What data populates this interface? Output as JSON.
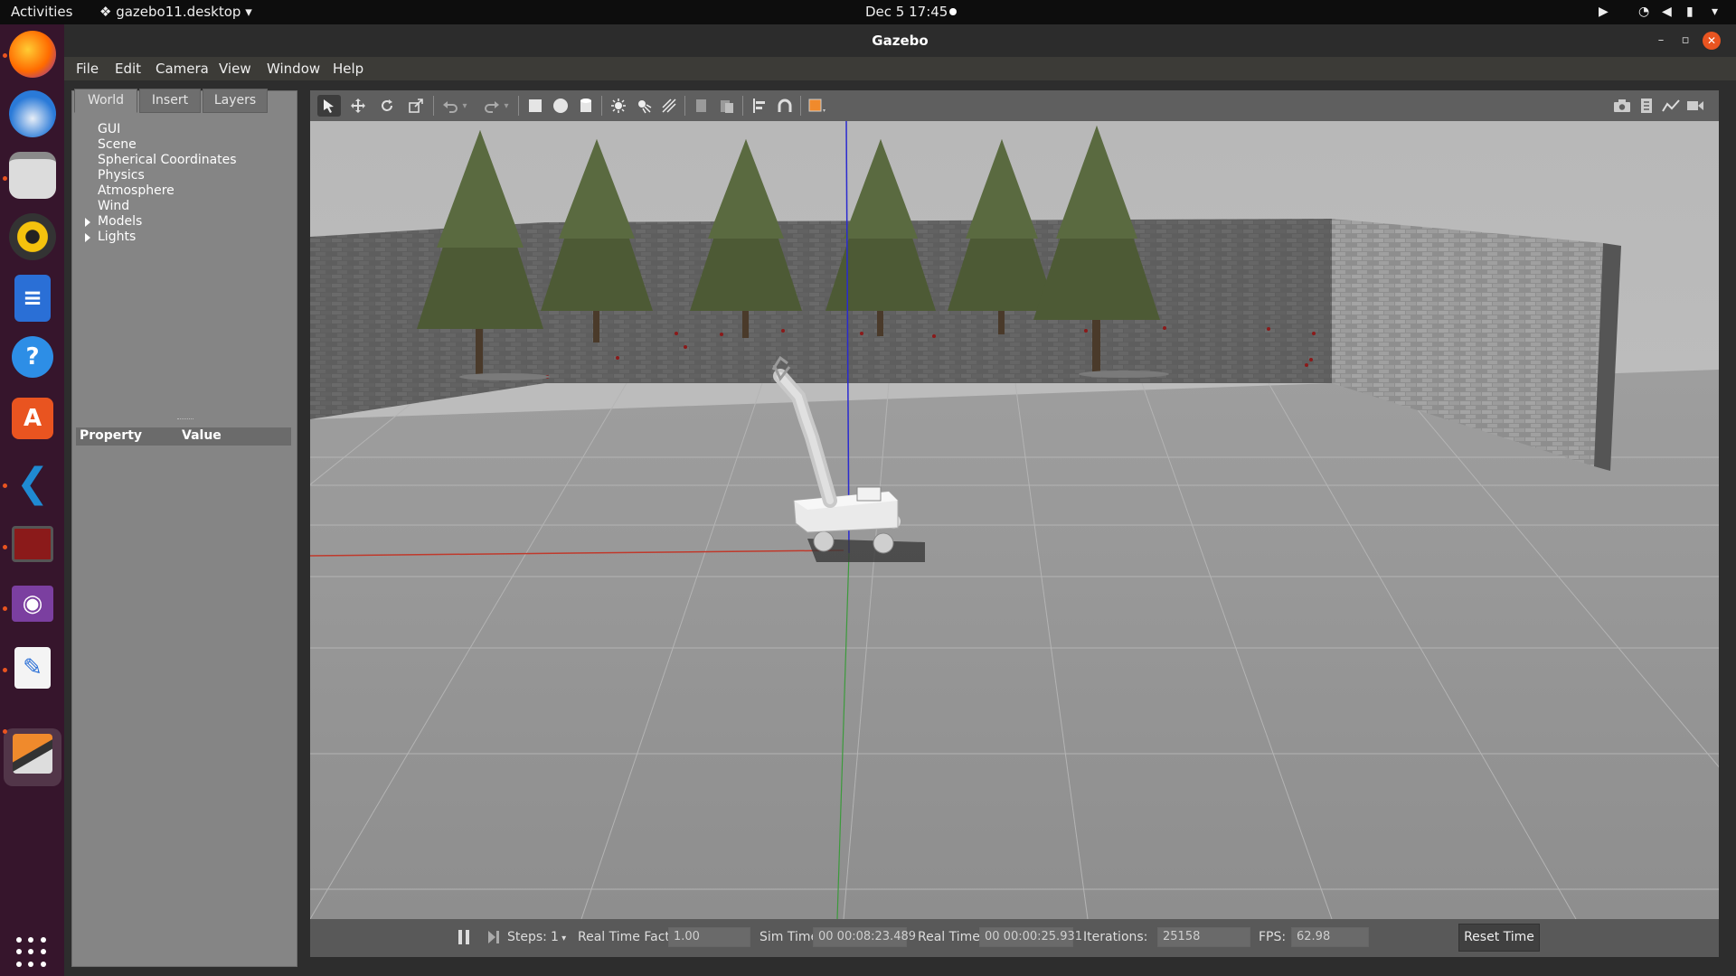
{
  "topbar": {
    "activities": "Activities",
    "app_menu": "gazebo11.desktop",
    "clock": "Dec 5  17:45"
  },
  "dock": {
    "items": [
      {
        "icon": "firefox-icon",
        "color": "#ff7139"
      },
      {
        "icon": "thunderbird-icon",
        "color": "#2a7ad8"
      },
      {
        "icon": "files-icon",
        "color": "#e5e5e5"
      },
      {
        "icon": "rhythmbox-icon",
        "color": "#f4c20d"
      },
      {
        "icon": "libreoffice-writer-icon",
        "color": "#2a6fd6"
      },
      {
        "icon": "help-icon",
        "color": "#2d8ee6"
      },
      {
        "icon": "software-icon",
        "color": "#e95420"
      },
      {
        "icon": "vscode-icon",
        "color": "#1f8ad2"
      },
      {
        "icon": "terminal-icon",
        "color": "#b22222"
      },
      {
        "icon": "video-icon",
        "color": "#7b3fa0"
      },
      {
        "icon": "text-editor-icon",
        "color": "#ffffff"
      },
      {
        "icon": "gazebo-icon",
        "color": "#f08a2c"
      }
    ]
  },
  "window": {
    "title": "Gazebo"
  },
  "menubar": {
    "file": "File",
    "edit": "Edit",
    "camera": "Camera",
    "view": "View",
    "window": "Window",
    "help": "Help"
  },
  "left_panel": {
    "tabs": [
      "World",
      "Insert",
      "Layers"
    ],
    "active_tab": "World",
    "tree": [
      "GUI",
      "Scene",
      "Spherical Coordinates",
      "Physics",
      "Atmosphere",
      "Wind",
      "Models",
      "Lights"
    ],
    "property_header": "Property",
    "value_header": "Value"
  },
  "bottom_bar": {
    "steps_label": "Steps:",
    "steps_value": "1",
    "rtf_label": "Real Time Factor:",
    "rtf_value": "1.00",
    "sim_time_label": "Sim Time:",
    "sim_time_value": "00 00:08:23.489",
    "real_time_label": "Real Time:",
    "real_time_value": "00 00:00:25.931",
    "iterations_label": "Iterations:",
    "iterations_value": "25158",
    "fps_label": "FPS:",
    "fps_value": "62.98",
    "reset_label": "Reset Time"
  },
  "colors": {
    "accent": "#e95420",
    "sky": "#bdbdbd",
    "ground": "#9a9a9a",
    "x_axis": "#c0392b",
    "y_axis": "#3c9a3c",
    "z_axis": "#2a2ad0"
  }
}
